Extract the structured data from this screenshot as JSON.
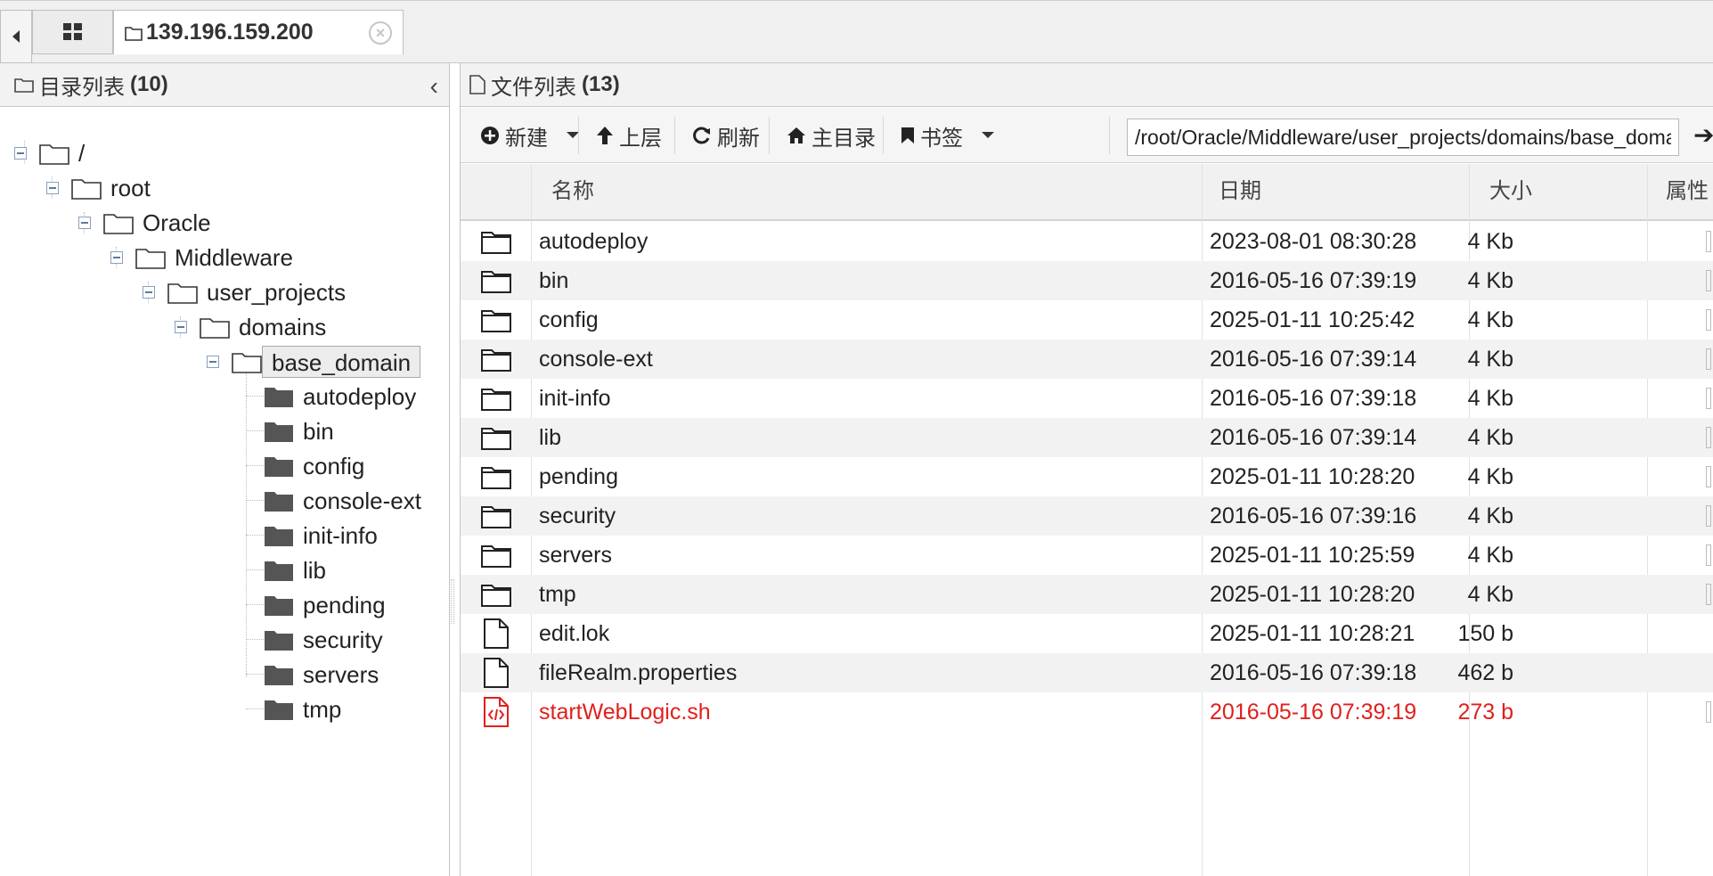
{
  "tabs": {
    "host_label": "139.196.159.200"
  },
  "left_panel": {
    "title": "目录列表",
    "count": "(10)",
    "tree": [
      {
        "label": "/"
      },
      {
        "label": "root"
      },
      {
        "label": "Oracle"
      },
      {
        "label": "Middleware"
      },
      {
        "label": "user_projects"
      },
      {
        "label": "domains"
      },
      {
        "label": "base_domain"
      },
      {
        "label": "autodeploy"
      },
      {
        "label": "bin"
      },
      {
        "label": "config"
      },
      {
        "label": "console-ext"
      },
      {
        "label": "init-info"
      },
      {
        "label": "lib"
      },
      {
        "label": "pending"
      },
      {
        "label": "security"
      },
      {
        "label": "servers"
      },
      {
        "label": "tmp"
      }
    ]
  },
  "right_panel": {
    "title": "文件列表",
    "count": "(13)",
    "toolbar": {
      "new_label": "新建",
      "up_label": "上层",
      "refresh_label": "刷新",
      "home_label": "主目录",
      "bookmark_label": "书签",
      "path_value": "/root/Oracle/Middleware/user_projects/domains/base_domain"
    },
    "columns": [
      "名称",
      "日期",
      "大小",
      "属性"
    ],
    "files": [
      {
        "name": "autodeploy",
        "date": "2023-08-01 08:30:28",
        "size": "4 Kb",
        "type": "folder"
      },
      {
        "name": "bin",
        "date": "2016-05-16 07:39:19",
        "size": "4 Kb",
        "type": "folder"
      },
      {
        "name": "config",
        "date": "2025-01-11 10:25:42",
        "size": "4 Kb",
        "type": "folder"
      },
      {
        "name": "console-ext",
        "date": "2016-05-16 07:39:14",
        "size": "4 Kb",
        "type": "folder"
      },
      {
        "name": "init-info",
        "date": "2016-05-16 07:39:18",
        "size": "4 Kb",
        "type": "folder"
      },
      {
        "name": "lib",
        "date": "2016-05-16 07:39:14",
        "size": "4 Kb",
        "type": "folder"
      },
      {
        "name": "pending",
        "date": "2025-01-11 10:28:20",
        "size": "4 Kb",
        "type": "folder"
      },
      {
        "name": "security",
        "date": "2016-05-16 07:39:16",
        "size": "4 Kb",
        "type": "folder"
      },
      {
        "name": "servers",
        "date": "2025-01-11 10:25:59",
        "size": "4 Kb",
        "type": "folder"
      },
      {
        "name": "tmp",
        "date": "2025-01-11 10:28:20",
        "size": "4 Kb",
        "type": "folder"
      },
      {
        "name": "edit.lok",
        "date": "2025-01-11 10:28:21",
        "size": "150 b",
        "type": "file"
      },
      {
        "name": "fileRealm.properties",
        "date": "2016-05-16 07:39:18",
        "size": "462 b",
        "type": "file"
      },
      {
        "name": "startWebLogic.sh",
        "date": "2016-05-16 07:39:19",
        "size": "273 b",
        "type": "script"
      }
    ]
  },
  "colors": {
    "script_text": "#e0201c",
    "row_alt": "#f2f2f2",
    "header_bg": "#f2f2f2"
  }
}
